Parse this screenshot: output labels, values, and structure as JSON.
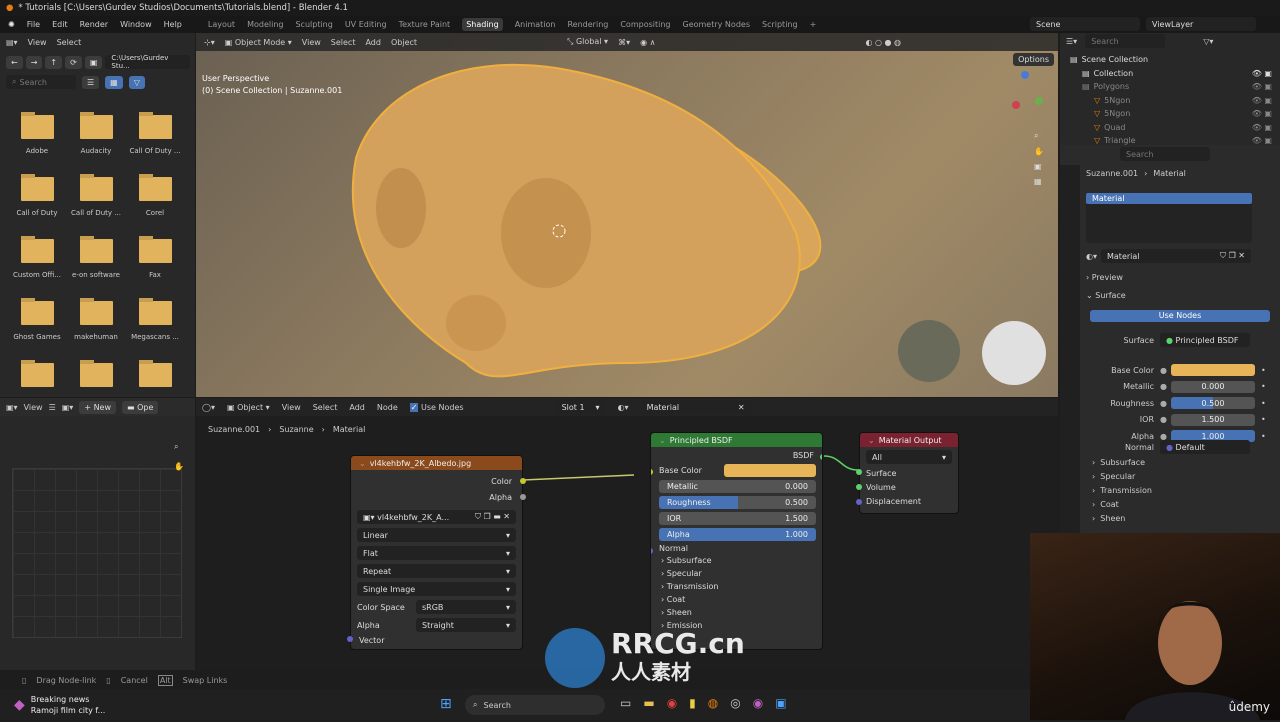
{
  "window": {
    "title": "* Tutorials [C:\\Users\\Gurdev Studios\\Documents\\Tutorials.blend] - Blender 4.1"
  },
  "menu": [
    "File",
    "Edit",
    "Render",
    "Window",
    "Help"
  ],
  "workspaces": [
    "Layout",
    "Modeling",
    "Sculpting",
    "UV Editing",
    "Texture Paint",
    "Shading",
    "Animation",
    "Rendering",
    "Compositing",
    "Geometry Nodes",
    "Scripting"
  ],
  "active_workspace": "Shading",
  "scene": {
    "scene_label": "Scene",
    "view_layer": "ViewLayer"
  },
  "file_browser": {
    "menu": [
      "View",
      "Select"
    ],
    "path": "C:\\Users\\Gurdev Stu...",
    "search_placeholder": "Search",
    "folders": [
      "Adobe",
      "Audacity",
      "Call Of Duty ...",
      "Call of Duty",
      "Call of Duty ...",
      "Corel",
      "Custom Offi...",
      "e-on software",
      "Fax",
      "Ghost Games",
      "makehuman",
      "Megascans ...",
      "",
      "",
      ""
    ]
  },
  "image_editor": {
    "view": "View",
    "new": "New",
    "open": "Ope"
  },
  "viewport": {
    "mode": "Object Mode",
    "menu": [
      "View",
      "Select",
      "Add",
      "Object"
    ],
    "transform": "Global",
    "options": "Options",
    "overlay_line1": "User Perspective",
    "overlay_line2": "(0) Scene Collection | Suzanne.001",
    "accent": "#e8b458"
  },
  "node_editor": {
    "type": "Object",
    "menu": [
      "View",
      "Select",
      "Add",
      "Node"
    ],
    "use_nodes": "Use Nodes",
    "slot": "Slot 1",
    "material": "Material",
    "breadcrumb": [
      "Suzanne.001",
      "Suzanne",
      "Material"
    ],
    "image_node": {
      "title": "vl4kehbfw_2K_Albedo.jpg",
      "out_color": "Color",
      "out_alpha": "Alpha",
      "image": "vl4kehbfw_2K_A...",
      "interp": "Linear",
      "proj": "Flat",
      "ext": "Repeat",
      "source": "Single Image",
      "cs_label": "Color Space",
      "cs": "sRGB",
      "alpha_label": "Alpha",
      "alpha": "Straight",
      "vector": "Vector",
      "header_color": "#8a4a1c"
    },
    "bsdf_node": {
      "title": "Principled BSDF",
      "out": "BSDF",
      "base_color": "Base Color",
      "metallic": {
        "label": "Metallic",
        "value": "0.000",
        "fill": 0
      },
      "roughness": {
        "label": "Roughness",
        "value": "0.500",
        "fill": 0.5
      },
      "ior": {
        "label": "IOR",
        "value": "1.500",
        "fill": 0
      },
      "alpha": {
        "label": "Alpha",
        "value": "1.000",
        "fill": 1
      },
      "normal": "Normal",
      "panels": [
        "Subsurface",
        "Specular",
        "Transmission",
        "Coat",
        "Sheen",
        "Emission"
      ],
      "header_color": "#2e7a35"
    },
    "output_node": {
      "title": "Material Output",
      "target": "All",
      "inputs": [
        "Surface",
        "Volume",
        "Displacement"
      ],
      "header_color": "#7a2230"
    }
  },
  "outliner": {
    "search_placeholder": "Search",
    "items": [
      {
        "name": "Scene Collection",
        "depth": 0
      },
      {
        "name": "Collection",
        "depth": 1
      },
      {
        "name": "Polygons",
        "depth": 1
      },
      {
        "name": "5Ngon",
        "depth": 2
      },
      {
        "name": "5Ngon",
        "depth": 2
      },
      {
        "name": "Quad",
        "depth": 2
      },
      {
        "name": "Triangle",
        "depth": 2
      }
    ]
  },
  "properties": {
    "search_placeholder": "Search",
    "breadcrumb": [
      "Suzanne.001",
      "Material"
    ],
    "slot": "Material",
    "material_name": "Material",
    "preview": "Preview",
    "surface": "Surface",
    "use_nodes": "Use Nodes",
    "surface_label": "Surface",
    "surface_value": "Principled BSDF",
    "rows": [
      {
        "label": "Base Color",
        "type": "color"
      },
      {
        "label": "Metallic",
        "value": "0.000",
        "fill": 0
      },
      {
        "label": "Roughness",
        "value": "0.500",
        "fill": 0.5
      },
      {
        "label": "IOR",
        "value": "1.500",
        "fill": 0
      },
      {
        "label": "Alpha",
        "value": "1.000",
        "fill": 1
      }
    ],
    "normal_label": "Normal",
    "normal_value": "Default",
    "panels": [
      "Subsurface",
      "Specular",
      "Transmission",
      "Coat",
      "Sheen"
    ]
  },
  "status": {
    "drag": "Drag Node-link",
    "cancel": "Cancel",
    "alt": "Alt",
    "swap": "Swap Links"
  },
  "taskbar": {
    "search": "Search",
    "news_title": "Breaking news",
    "news_text": "Ramoji film city f..."
  },
  "watermark": {
    "text": "RRCG.cn",
    "sub": "人人素材",
    "udemy": "ûdemy"
  }
}
